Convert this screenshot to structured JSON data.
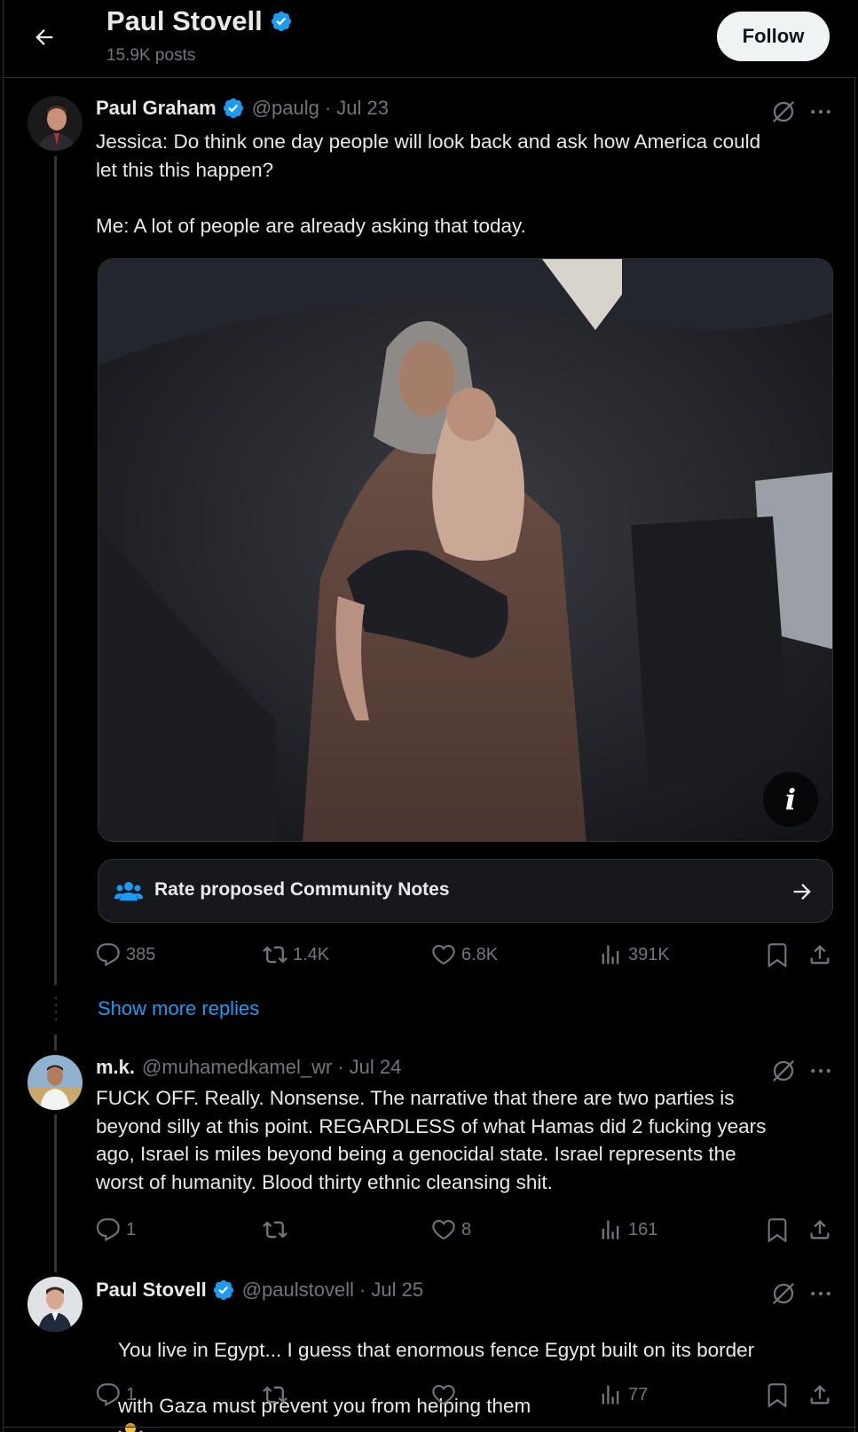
{
  "header": {
    "title": "Paul Stovell",
    "posts_count": "15.9K posts",
    "follow_label": "Follow"
  },
  "tweets": [
    {
      "name": "Paul Graham",
      "handle": "@paulg",
      "date": "Jul 23",
      "verified": true,
      "text": "Jessica: Do think one day people will look back and ask how America could\nlet this this happen?\n\nMe: A lot of people are already asking that today.",
      "community_notes_label": "Rate proposed Community Notes",
      "replies": "385",
      "reposts": "1.4K",
      "likes": "6.8K",
      "views": "391K"
    },
    {
      "name": "m.k.",
      "handle": "@muhamedkamel_wr",
      "date": "Jul 24",
      "verified": false,
      "text": "FUCK OFF. Really. Nonsense. The narrative that there are two parties is\nbeyond silly at this point. REGARDLESS of what Hamas did 2 fucking years\nago, Israel is miles beyond being a genocidal state. Israel represents the\nworst of humanity. Blood thirty ethnic cleansing shit.",
      "replies": "1",
      "reposts": "",
      "likes": "8",
      "views": "161"
    },
    {
      "name": "Paul Stovell",
      "handle": "@paulstovell",
      "date": "Jul 25",
      "verified": true,
      "text_line1": "You live in Egypt... I guess that enormous fence Egypt built on its border",
      "text_line2": "with Gaza must prevent you from helping them",
      "replies": "1",
      "reposts": "",
      "likes": "",
      "views": "77"
    }
  ],
  "show_more_replies": "Show more replies",
  "icons": {
    "back": "arrow-left-icon",
    "verified": "verified-badge-icon",
    "grok": "grok-icon",
    "more": "more-icon",
    "reply": "reply-icon",
    "repost": "repost-icon",
    "like": "heart-icon",
    "views": "views-icon",
    "bookmark": "bookmark-icon",
    "share": "share-icon",
    "community": "people-icon",
    "arrow_right": "arrow-right-icon",
    "info": "info-icon"
  },
  "colors": {
    "background": "#000000",
    "accent": "#1d9bf0",
    "text": "#e7e9ea",
    "muted": "#71767b",
    "border": "#2f3336"
  }
}
